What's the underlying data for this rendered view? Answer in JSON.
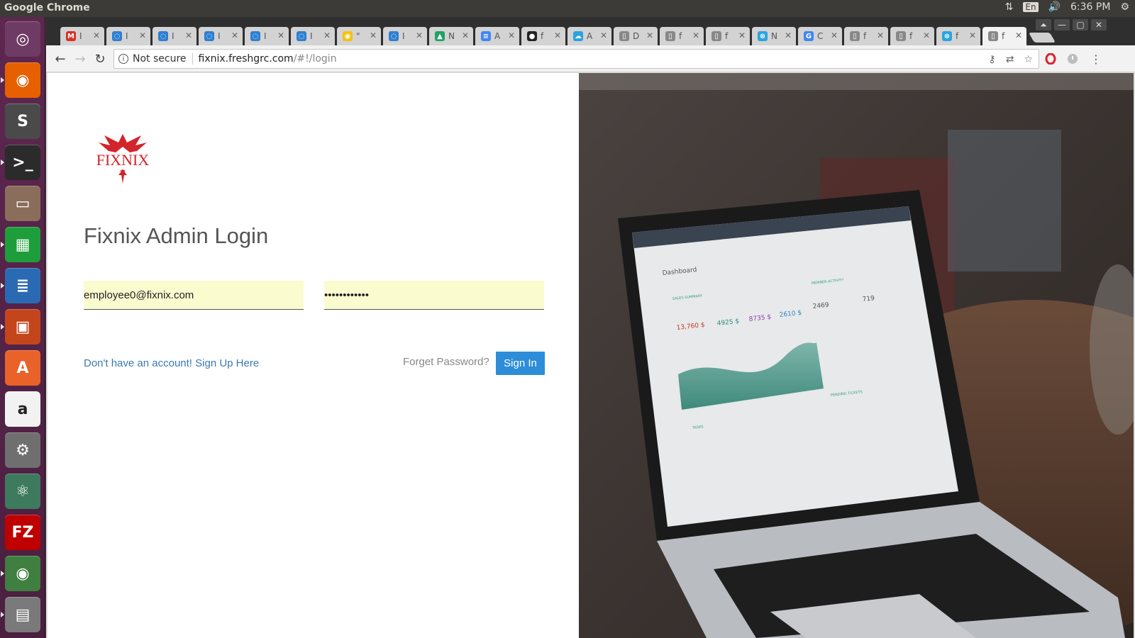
{
  "os": {
    "app_title": "Google Chrome",
    "language": "En",
    "clock": "6:36 PM"
  },
  "launcher": {
    "items": [
      {
        "name": "ubuntu-dash-icon",
        "glyph": "◎",
        "color": "#6d3b63"
      },
      {
        "name": "firefox-icon",
        "glyph": "◉",
        "color": "#e66000"
      },
      {
        "name": "sublime-text-icon",
        "glyph": "S",
        "color": "#4a4a4a"
      },
      {
        "name": "terminal-icon",
        "glyph": ">_",
        "color": "#2b2b2b"
      },
      {
        "name": "files-icon",
        "glyph": "▭",
        "color": "#8a6d5a"
      },
      {
        "name": "libreoffice-calc-icon",
        "glyph": "▦",
        "color": "#1e9e3a"
      },
      {
        "name": "libreoffice-writer-icon",
        "glyph": "≣",
        "color": "#2a6ab3"
      },
      {
        "name": "libreoffice-impress-icon",
        "glyph": "▣",
        "color": "#c4451c"
      },
      {
        "name": "software-center-icon",
        "glyph": "A",
        "color": "#e8622a"
      },
      {
        "name": "amazon-icon",
        "glyph": "a",
        "color": "#f2f2f2"
      },
      {
        "name": "system-settings-icon",
        "glyph": "⚙",
        "color": "#6f6f6f"
      },
      {
        "name": "atom-icon",
        "glyph": "⚛",
        "color": "#3d7a5e"
      },
      {
        "name": "filezilla-icon",
        "glyph": "FZ",
        "color": "#bf0000"
      },
      {
        "name": "chrome-icon",
        "glyph": "◉",
        "color": "#3f7f3f"
      },
      {
        "name": "scanner-icon",
        "glyph": "▤",
        "color": "#7a7a7a"
      }
    ]
  },
  "browser": {
    "tabs": [
      {
        "fav": "M",
        "color": "#d93025",
        "short": "I"
      },
      {
        "fav": "◌",
        "color": "#2e7fd1",
        "short": "I"
      },
      {
        "fav": "◌",
        "color": "#2e7fd1",
        "short": "I"
      },
      {
        "fav": "◌",
        "color": "#2e7fd1",
        "short": "I"
      },
      {
        "fav": "◌",
        "color": "#2e7fd1",
        "short": "I"
      },
      {
        "fav": "◌",
        "color": "#2e7fd1",
        "short": "I"
      },
      {
        "fav": "◉",
        "color": "#f4c20d",
        "short": "\""
      },
      {
        "fav": "◌",
        "color": "#2e7fd1",
        "short": "I"
      },
      {
        "fav": "▲",
        "color": "#1fa463",
        "short": "N"
      },
      {
        "fav": "≡",
        "color": "#4285f4",
        "short": "A"
      },
      {
        "fav": "●",
        "color": "#222222",
        "short": "f"
      },
      {
        "fav": "☁",
        "color": "#2aa3e0",
        "short": "A"
      },
      {
        "fav": "▯",
        "color": "#888888",
        "short": "D"
      },
      {
        "fav": "▯",
        "color": "#888888",
        "short": "f"
      },
      {
        "fav": "▯",
        "color": "#888888",
        "short": "f"
      },
      {
        "fav": "⊛",
        "color": "#2aa3e0",
        "short": "N"
      },
      {
        "fav": "G",
        "color": "#4285f4",
        "short": "C"
      },
      {
        "fav": "▯",
        "color": "#888888",
        "short": "f"
      },
      {
        "fav": "▯",
        "color": "#888888",
        "short": "f"
      },
      {
        "fav": "⊛",
        "color": "#2aa3e0",
        "short": "f"
      },
      {
        "fav": "▯",
        "color": "#888888",
        "short": "f",
        "active": true
      }
    ],
    "security_label": "Not secure",
    "url_host": "fixnix.freshgrc.com",
    "url_path": "/#!/login"
  },
  "login": {
    "brand": "FIXNIX",
    "title": "Fixnix Admin Login",
    "email_value": "employee0@fixnix.com",
    "password_value": "••••••••••••",
    "signup_text": "Don't have an account! Sign Up Here",
    "forget_text": "Forget Password?",
    "signin_label": "Sign In",
    "accent": "#2d8dd8",
    "brand_color": "#d3242b"
  },
  "hero_screen": {
    "app_title": "Dashboard",
    "panel_sales": "SALES SUMMARY",
    "panel_activity": "MEMBER ACTIVITY",
    "total_sales": "13,760 $",
    "profit": "4925 $",
    "expenses": "8735 $",
    "growth": "2610 $",
    "stat_a": "2469",
    "stat_b": "719",
    "tasks": "TASKS",
    "pending": "PENDING TICKETS"
  }
}
